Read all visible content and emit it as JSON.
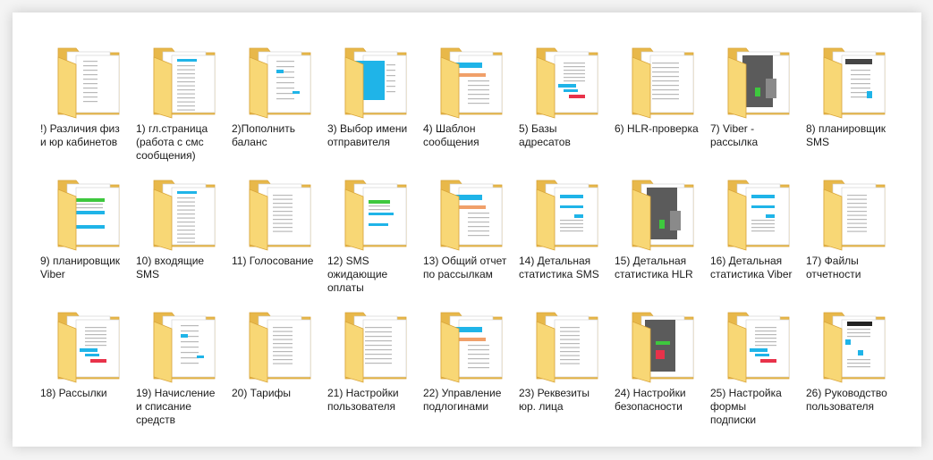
{
  "folders": [
    {
      "name": "!) Различия физ\nи юр кабинетов",
      "align": "left",
      "style": "a"
    },
    {
      "name": "1) гл.страница\n(работа с смс\nсообщения)",
      "align": "left",
      "style": "b"
    },
    {
      "name": "2)Пополнить\nбаланс",
      "align": "left",
      "style": "c"
    },
    {
      "name": "3) Выбор имени\nотправителя",
      "align": "left",
      "style": "d"
    },
    {
      "name": "4) Шаблон\nсообщения",
      "align": "left",
      "style": "e"
    },
    {
      "name": "5) Базы\nадресатов",
      "align": "left",
      "style": "f"
    },
    {
      "name": "6) HLR-проверка",
      "align": "left",
      "style": "g"
    },
    {
      "name": "7) Viber -\nрассылка",
      "align": "left",
      "style": "h"
    },
    {
      "name": "8) планировщик\nSMS",
      "align": "left",
      "style": "i"
    },
    {
      "name": "9) планировщик\nViber",
      "align": "left",
      "style": "j"
    },
    {
      "name": "10) входящие\nSMS",
      "align": "left",
      "style": "b"
    },
    {
      "name": "11) Голосование",
      "align": "left",
      "style": "k"
    },
    {
      "name": "12) SMS\nожидающие\nоплаты",
      "align": "left",
      "style": "l"
    },
    {
      "name": "13) Общий отчет\nпо рассылкам",
      "align": "left",
      "style": "e"
    },
    {
      "name": "14) Детальная\nстатистика SMS",
      "align": "left",
      "style": "m"
    },
    {
      "name": "15) Детальная\nстатистика HLR",
      "align": "left",
      "style": "h"
    },
    {
      "name": "16) Детальная\nстатистика Viber",
      "align": "left",
      "style": "m"
    },
    {
      "name": "17) Файлы\nотчетности",
      "align": "left",
      "style": "k"
    },
    {
      "name": "18) Рассылки",
      "align": "left",
      "style": "f"
    },
    {
      "name": "19) Начисление\nи списание\nсредств",
      "align": "left",
      "style": "c"
    },
    {
      "name": "20) Тарифы",
      "align": "left",
      "style": "k"
    },
    {
      "name": "21) Настройки\nпользователя",
      "align": "left",
      "style": "g"
    },
    {
      "name": "22) Управление\nподлогинами",
      "align": "left",
      "style": "e"
    },
    {
      "name": "23) Реквезиты\nюр. лица",
      "align": "left",
      "style": "k"
    },
    {
      "name": "24) Настройки\nбезопасности",
      "align": "left",
      "style": "n"
    },
    {
      "name": "25) Настройка\nформы\nподписки",
      "align": "left",
      "style": "f"
    },
    {
      "name": "26) Руководство\nпользователя",
      "align": "left",
      "style": "o"
    }
  ],
  "colors": {
    "folder_back": "#e8b84a",
    "folder_front": "#f8d775",
    "folder_edge": "#d9a53b",
    "accent_blue": "#1fb4e8",
    "accent_green": "#3ec83e",
    "accent_red": "#e8324a",
    "dark_gray": "#5b5b5b"
  }
}
